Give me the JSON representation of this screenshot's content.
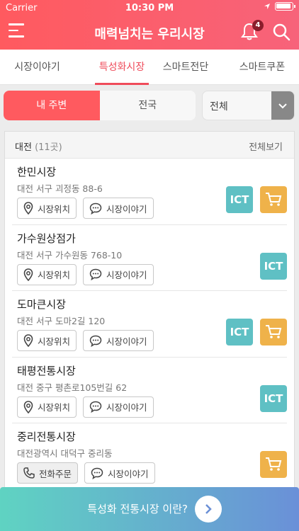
{
  "status_bar": {
    "carrier": "Carrier",
    "time": "10:30 PM"
  },
  "header": {
    "title": "매력넘치는 우리시장",
    "notification_count": "4"
  },
  "tabs": [
    {
      "label": "시장이야기",
      "active": false
    },
    {
      "label": "특성화시장",
      "active": true
    },
    {
      "label": "스마트전단",
      "active": false
    },
    {
      "label": "스마트쿠폰",
      "active": false
    }
  ],
  "filters": {
    "nearby_label": "내 주변",
    "nationwide_label": "전국",
    "select_value": "전체"
  },
  "list": {
    "region": "대전",
    "count": "(11곳)",
    "view_all": "전체보기",
    "items": [
      {
        "name": "한민시장",
        "address": "대전 서구 괴정동 88-6",
        "btn1": "시장위치",
        "btn2": "시장이야기",
        "ict": true,
        "cart": true
      },
      {
        "name": "가수원상점가",
        "address": "대전 서구 가수원동 768-10",
        "btn1": "시장위치",
        "btn2": "시장이야기",
        "ict": true,
        "cart": false
      },
      {
        "name": "도마큰시장",
        "address": "대전 서구 도마2길 120",
        "btn1": "시장위치",
        "btn2": "시장이야기",
        "ict": true,
        "cart": true
      },
      {
        "name": "태평전통시장",
        "address": "대전 중구 평촌로105번길 62",
        "btn1": "시장위치",
        "btn2": "시장이야기",
        "ict": true,
        "cart": false
      },
      {
        "name": "중리전통시장",
        "address": "대전광역시 대덕구 중리동",
        "btn1": "전화주문",
        "btn2": "시장이야기",
        "ict": false,
        "cart": true
      }
    ],
    "ict_label": "ICT"
  },
  "bottom_banner": {
    "text": "특성화 전통시장 이란?"
  },
  "colors": {
    "accent": "#ff5a5f",
    "ict": "#5fc0c4",
    "cart": "#efb24a"
  }
}
